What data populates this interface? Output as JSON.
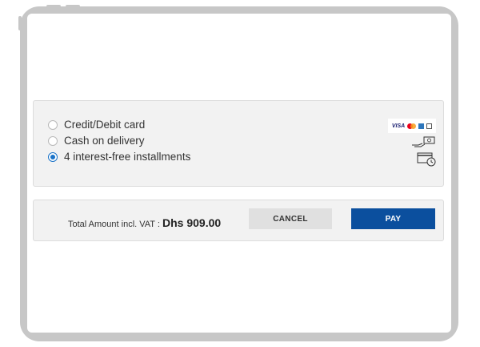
{
  "payment": {
    "options": [
      {
        "label": "Credit/Debit card",
        "selected": false
      },
      {
        "label": "Cash on delivery",
        "selected": false
      },
      {
        "label": "4 interest-free installments",
        "selected": true
      }
    ],
    "card_brands": [
      "VISA",
      "mastercard",
      "amex",
      "diners"
    ],
    "icons": {
      "card": "card-brands-icon",
      "cash": "cash-hand-icon",
      "installments": "card-clock-icon"
    }
  },
  "summary": {
    "total_label": "Total Amount incl. VAT : ",
    "total_value": "Dhs 909.00",
    "cancel_label": "CANCEL",
    "pay_label": "PAY"
  },
  "colors": {
    "accent": "#1a73c8",
    "pay_button": "#0b4f9e",
    "cancel_button": "#e0e0e0",
    "frame": "#c7c7c7",
    "panel": "#f2f2f2"
  }
}
